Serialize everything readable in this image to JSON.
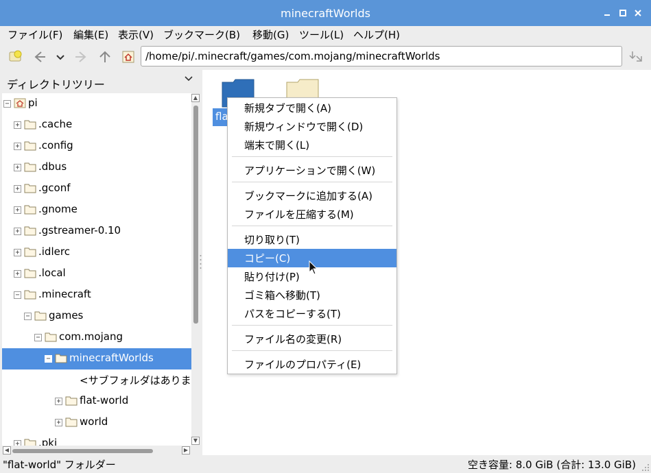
{
  "window": {
    "title": "minecraftWorlds"
  },
  "menubar": [
    "ファイル(F)",
    "編集(E)",
    "表示(V)",
    "ブックマーク(B)",
    "移動(G)",
    "ツール(L)",
    "ヘルプ(H)"
  ],
  "toolbar": {
    "path": "/home/pi/.minecraft/games/com.mojang/minecraftWorlds"
  },
  "sidebar": {
    "header": "ディレクトリツリー",
    "tree": [
      {
        "label": "pi",
        "exp": "−"
      },
      {
        "label": ".cache",
        "exp": "+"
      },
      {
        "label": ".config",
        "exp": "+"
      },
      {
        "label": ".dbus",
        "exp": "+"
      },
      {
        "label": ".gconf",
        "exp": "+"
      },
      {
        "label": ".gnome",
        "exp": "+"
      },
      {
        "label": ".gstreamer-0.10",
        "exp": "+"
      },
      {
        "label": ".idlerc",
        "exp": "+"
      },
      {
        "label": ".local",
        "exp": "+"
      },
      {
        "label": ".minecraft",
        "exp": "−"
      },
      {
        "label": "games",
        "exp": "−"
      },
      {
        "label": "com.mojang",
        "exp": "−"
      },
      {
        "label": "minecraftWorlds",
        "exp": "−"
      },
      {
        "label": "<サブフォルダはありま"
      },
      {
        "label": "flat-world",
        "exp": "+"
      },
      {
        "label": "world",
        "exp": "+"
      },
      {
        "label": ".pki",
        "exp": "+"
      }
    ]
  },
  "files": {
    "first_label": "fla"
  },
  "context_menu": {
    "items": [
      "新規タブで開く(A)",
      "新規ウィンドウで開く(D)",
      "端末で開く(L)",
      "アプリケーションで開く(W)",
      "ブックマークに追加する(A)",
      "ファイルを圧縮する(M)",
      "切り取り(T)",
      "コピー(C)",
      "貼り付け(P)",
      "ゴミ箱へ移動(T)",
      "パスをコピーする(T)",
      "ファイル名の変更(R)",
      "ファイルのプロパティ(E)"
    ],
    "highlighted": "コピー(C)"
  },
  "statusbar": {
    "left": "\"flat-world\" フォルダー",
    "right": "空き容量: 8.0 GiB (合計: 13.0 GiB)"
  },
  "colors": {
    "titlebar": "#5a95d8",
    "selection": "#4f8fe0",
    "chrome": "#ededed"
  }
}
